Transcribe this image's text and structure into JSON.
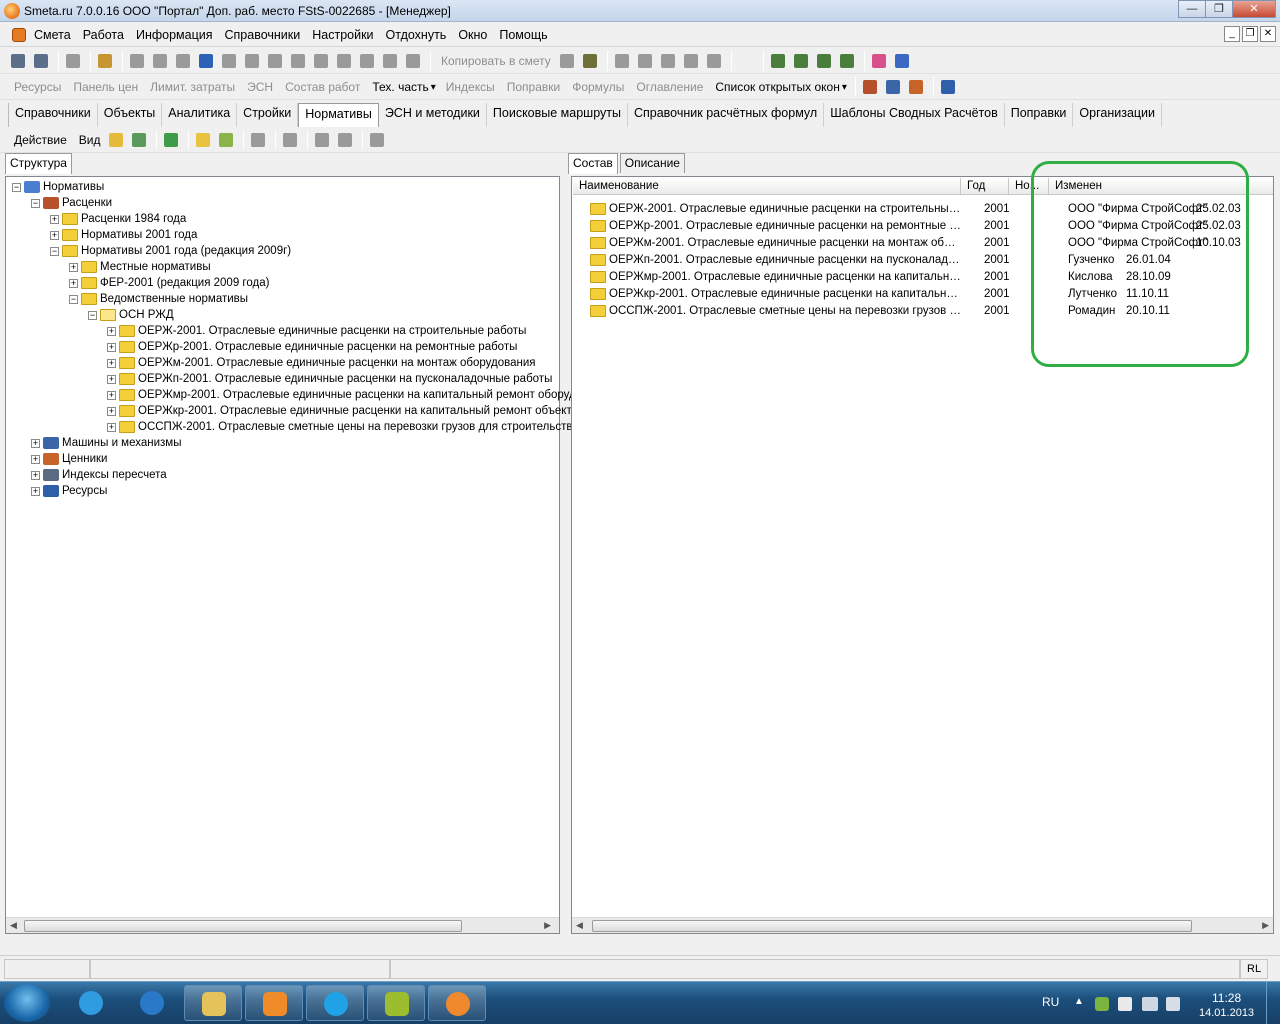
{
  "window": {
    "title": "Smeta.ru  7.0.0.16  ООО \"Портал\"  Доп. раб. место  FStS-0022685 - [Менеджер]",
    "min": "0",
    "max": "1",
    "close": "r"
  },
  "menu": {
    "items": [
      "Смета",
      "Работа",
      "Информация",
      "Справочники",
      "Настройки",
      "Отдохнуть",
      "Окно",
      "Помощь"
    ],
    "mdi": [
      "_",
      "❐",
      "✕"
    ]
  },
  "toolbar2": {
    "copy_to_estimate": "Копировать в смету"
  },
  "toolbar3": {
    "items": [
      "Ресурсы",
      "Панель цен",
      "Лимит. затраты",
      "ЭСН",
      "Состав работ",
      "Тех. часть",
      "Индексы",
      "Поправки",
      "Формулы",
      "Оглавление",
      "Список открытых окон"
    ],
    "enabled": [
      "Тех. часть",
      "Список открытых окон"
    ],
    "dropdown_arrow": "▾"
  },
  "tabs": {
    "items": [
      "Справочники",
      "Объекты",
      "Аналитика",
      "Стройки",
      "Нормативы",
      "ЭСН и методики",
      "Поисковые маршруты",
      "Справочник расчётных формул",
      "Шаблоны Сводных Расчётов",
      "Поправки",
      "Организации"
    ],
    "active": "Нормативы"
  },
  "actions": {
    "action": "Действие",
    "view": "Вид"
  },
  "left_pane": {
    "tab": "Структура",
    "tree": [
      {
        "label": "Нормативы",
        "level": 0,
        "exp": "−",
        "icon": "book-icon"
      },
      {
        "label": "Расценки",
        "level": 1,
        "exp": "−",
        "icon": "hammer-icon"
      },
      {
        "label": "Расценки 1984 года",
        "level": 2,
        "exp": "+",
        "icon": "folder-icon"
      },
      {
        "label": "Нормативы 2001 года",
        "level": 2,
        "exp": "+",
        "icon": "folder-icon"
      },
      {
        "label": "Нормативы 2001 года (редакция 2009г)",
        "level": 2,
        "exp": "−",
        "icon": "folder-icon"
      },
      {
        "label": "Местные нормативы",
        "level": 3,
        "exp": "+",
        "icon": "folder-icon"
      },
      {
        "label": "ФЕР-2001 (редакция 2009 года)",
        "level": 3,
        "exp": "+",
        "icon": "folder-icon"
      },
      {
        "label": "Ведомственные нормативы",
        "level": 3,
        "exp": "−",
        "icon": "folder-icon"
      },
      {
        "label": "ОСН РЖД",
        "level": 4,
        "exp": "−",
        "icon": "folder-open-icon"
      },
      {
        "label": "ОЕРЖ-2001. Отраслевые единичные расценки на строительные работы",
        "level": 5,
        "exp": "+",
        "icon": "folder-icon"
      },
      {
        "label": "ОЕРЖр-2001. Отраслевые единичные расценки на ремонтные работы",
        "level": 5,
        "exp": "+",
        "icon": "folder-icon"
      },
      {
        "label": "ОЕРЖм-2001. Отраслевые единичные расценки на монтаж оборудования",
        "level": 5,
        "exp": "+",
        "icon": "folder-icon"
      },
      {
        "label": "ОЕРЖп-2001. Отраслевые единичные расценки на пусконаладочные работы",
        "level": 5,
        "exp": "+",
        "icon": "folder-icon"
      },
      {
        "label": "ОЕРЖмр-2001. Отраслевые единичные расценки на капитальный ремонт оборуд",
        "level": 5,
        "exp": "+",
        "icon": "folder-icon"
      },
      {
        "label": "ОЕРЖкр-2001. Отраслевые единичные расценки на капитальный ремонт объект",
        "level": 5,
        "exp": "+",
        "icon": "folder-icon"
      },
      {
        "label": "ОССПЖ-2001. Отраслевые сметные цены на перевозки грузов для строительств",
        "level": 5,
        "exp": "+",
        "icon": "folder-icon"
      },
      {
        "label": "Машины и механизмы",
        "level": 1,
        "exp": "+",
        "icon": "truck-icon"
      },
      {
        "label": "Ценники",
        "level": 1,
        "exp": "+",
        "icon": "bricks-icon"
      },
      {
        "label": "Индексы пересчета",
        "level": 1,
        "exp": "+",
        "icon": "calculator-icon"
      },
      {
        "label": "Ресурсы",
        "level": 1,
        "exp": "+",
        "icon": "car-icon"
      }
    ]
  },
  "right_pane": {
    "tabs": [
      "Состав",
      "Описание"
    ],
    "active_tab": "Состав",
    "columns": [
      "Наименование",
      "Год",
      "Но...",
      "Изменен"
    ],
    "rows": [
      {
        "name": "ОЕРЖ-2001. Отраслевые единичные расценки на строительные р...",
        "year": "2001",
        "by": "ООО \"Фирма СтройСофт\"",
        "date": "25.02.03"
      },
      {
        "name": "ОЕРЖр-2001. Отраслевые единичные расценки на ремонтные раб...",
        "year": "2001",
        "by": "ООО \"Фирма СтройСофт\"",
        "date": "25.02.03"
      },
      {
        "name": "ОЕРЖм-2001. Отраслевые единичные расценки на монтаж оборуд...",
        "year": "2001",
        "by": "ООО \"Фирма СтройСофт\"",
        "date": "10.10.03"
      },
      {
        "name": "ОЕРЖп-2001. Отраслевые единичные расценки на пусконаладочн...",
        "year": "2001",
        "by": "Гузченко",
        "date": "26.01.04"
      },
      {
        "name": "ОЕРЖмр-2001. Отраслевые единичные расценки на капитальный ...",
        "year": "2001",
        "by": "Кислова",
        "date": "28.10.09"
      },
      {
        "name": "ОЕРЖкр-2001. Отраслевые единичные расценки на капитальный ...",
        "year": "2001",
        "by": "Лутченко",
        "date": "11.10.11"
      },
      {
        "name": "ОССПЖ-2001. Отраслевые сметные цены на перевозки грузов дл...",
        "year": "2001",
        "by": "Ромадин",
        "date": "20.10.11"
      }
    ],
    "highlight_color": "#2fae43"
  },
  "statusbar": {
    "lang": "RL"
  },
  "taskbar": {
    "lang": "RU",
    "time": "11:28",
    "date": "14.01.2013",
    "apps": [
      "ie-icon",
      "maxthon-icon",
      "explorer-icon",
      "media-player-icon",
      "skype-icon",
      "smeta-tool-icon",
      "smeta-icon"
    ]
  }
}
